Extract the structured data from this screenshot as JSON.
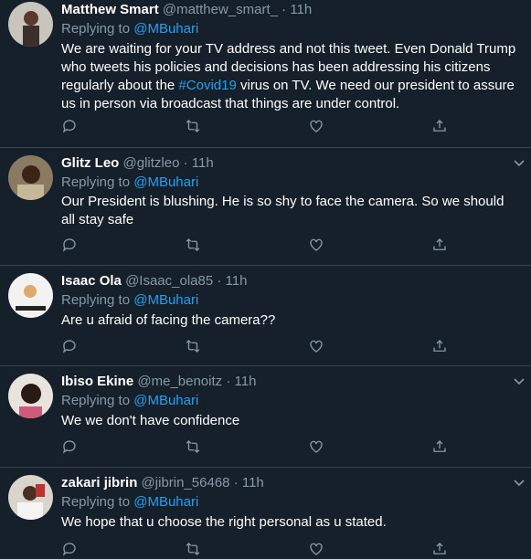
{
  "tweets": [
    {
      "name": "Matthew Smart",
      "handle": "@matthew_smart_",
      "time": "11h",
      "replying_to": "Replying to",
      "mention": "@MBuhari",
      "text_before": "We are waiting for your TV address and not this tweet. Even Donald Trump who tweets his policies and decisions has been addressing his citizens regularly about the ",
      "hashtag": "#Covid19",
      "text_after": " virus on TV. We need our president to assure us in person via broadcast that things are under control."
    },
    {
      "name": "Glitz Leo",
      "handle": "@glitzleo",
      "time": "11h",
      "replying_to": "Replying to",
      "mention": "@MBuhari",
      "text": "Our President is blushing. He is so shy to face the camera. So we should all stay safe"
    },
    {
      "name": "Isaac Ola",
      "handle": "@Isaac_ola85",
      "time": "11h",
      "replying_to": "Replying to",
      "mention": "@MBuhari",
      "text": "Are u afraid of facing the camera??"
    },
    {
      "name": "Ibiso Ekine",
      "handle": "@me_benoitz",
      "time": "11h",
      "replying_to": "Replying to",
      "mention": "@MBuhari",
      "text": "We we don't have confidence"
    },
    {
      "name": "zakari jibrin",
      "handle": "@jibrin_56468",
      "time": "11h",
      "replying_to": "Replying to",
      "mention": "@MBuhari",
      "text": "We hope that u choose the right personal as u stated."
    }
  ],
  "separator": "·",
  "icons": [
    "reply-icon",
    "retweet-icon",
    "like-icon",
    "share-icon",
    "more-caret-icon"
  ],
  "colors": {
    "background": "#15202b",
    "link": "#1da1f2",
    "muted": "#8899a6",
    "border": "#38444d"
  }
}
